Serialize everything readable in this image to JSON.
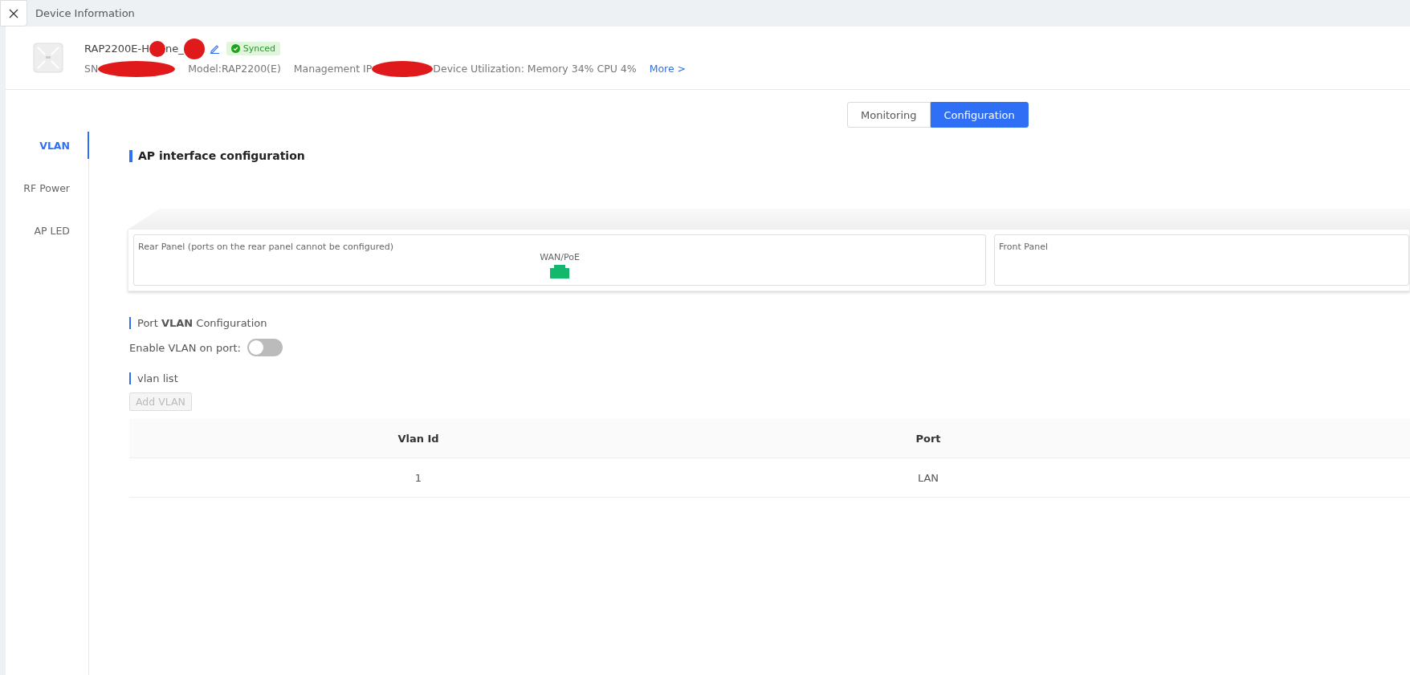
{
  "window": {
    "title": "Device Information"
  },
  "device": {
    "name_parts": [
      "RAP2200E-H",
      "ne_"
    ],
    "status": "Synced",
    "sn_label": "SN",
    "model": "Model:RAP2200(E)",
    "ip_label": "Management IP",
    "utilization": "Device Utilization: Memory 34% CPU 4%",
    "more_link": "More >"
  },
  "view_tabs": [
    {
      "label": "Monitoring",
      "selected": false
    },
    {
      "label": "Configuration",
      "selected": true
    }
  ],
  "sidebar": {
    "items": [
      {
        "label": "VLAN",
        "selected": true
      },
      {
        "label": "RF Power",
        "selected": false
      },
      {
        "label": "AP LED",
        "selected": false
      }
    ]
  },
  "section_title": "AP interface configuration",
  "panels": [
    {
      "title": "Rear Panel (ports on the rear panel cannot be configured)",
      "ports": [
        {
          "label": "WAN/PoE",
          "color": "#13b86c"
        }
      ]
    },
    {
      "title": "Front Panel"
    }
  ],
  "port_vlan": {
    "title": "Port **VLAN** Configuration",
    "toggle_label": "Enable VLAN on port:",
    "on": false
  },
  "vlan_list": {
    "title": "vlan list",
    "add_button": {
      "label": "Add VLAN",
      "disabled": true
    }
  },
  "table": {
    "columns": [
      "Vlan Id",
      "Port"
    ],
    "rows": [
      [
        "1",
        "LAN"
      ]
    ]
  }
}
